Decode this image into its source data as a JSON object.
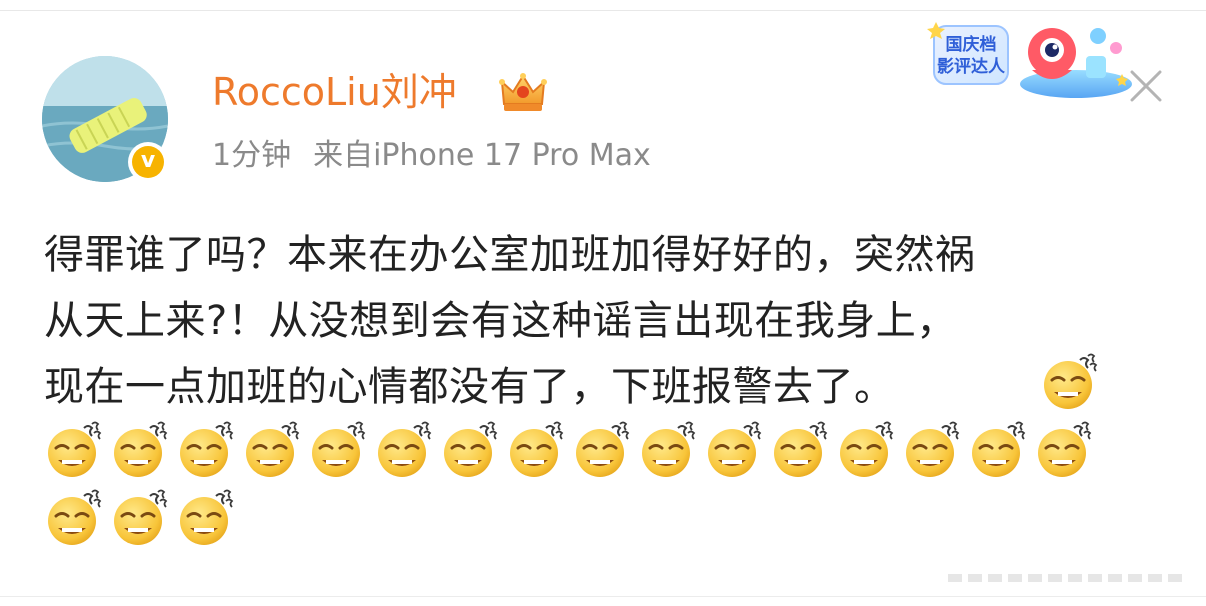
{
  "post": {
    "username": "RoccoLiu刘冲",
    "time": "1分钟",
    "source": "来自iPhone 17 Pro Max",
    "verified_mark": "v",
    "badge_text_line1": "国庆档",
    "badge_text_line2": "影评达人",
    "text_lines": [
      "得罪谁了吗？本来在办公室加班加得好好的，突然祸",
      "从天上来?！从没想到会有这种谣言出现在我身上，",
      "现在一点加班的心情都没有了，下班报警去了。"
    ],
    "emoji_name": "doge-sweat-emoji",
    "emoji_count": 20
  },
  "icons": {
    "crown": "crown-icon",
    "close": "close-icon"
  },
  "colors": {
    "username": "#ee7a2c",
    "meta": "#8a8a8a",
    "text": "#222222",
    "verified": "#f7b300"
  }
}
